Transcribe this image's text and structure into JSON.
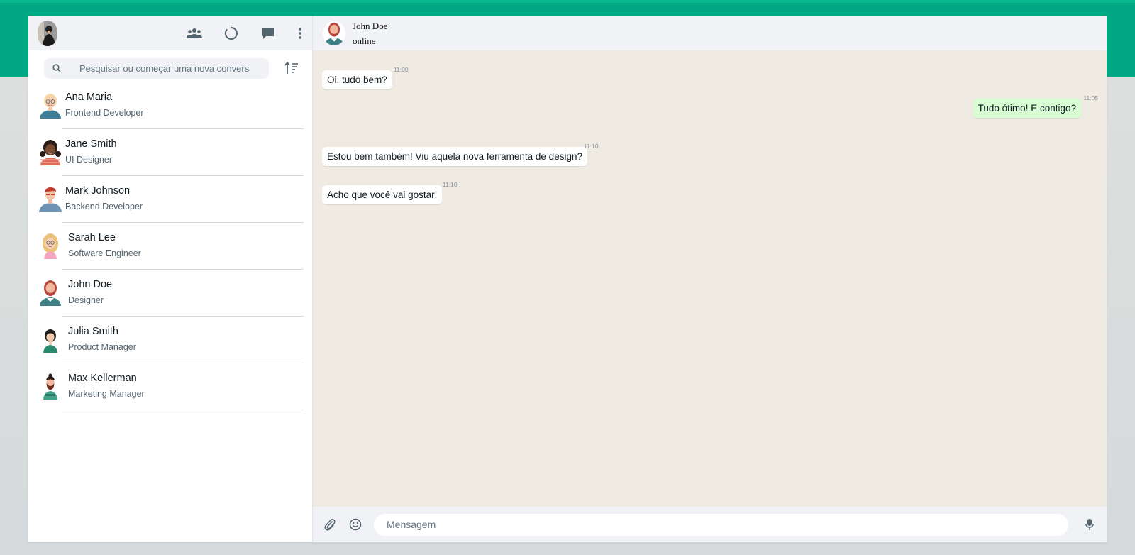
{
  "colors": {
    "accent": "#00a884",
    "panel": "#f0f2f5",
    "chat_bg": "#efeae2",
    "bubble_out": "#d9fdd3",
    "icon": "#54656f"
  },
  "sidebar": {
    "header_icons": [
      "community-icon",
      "status-icon",
      "new-chat-icon",
      "menu-icon"
    ],
    "search": {
      "placeholder": "Pesquisar ou começar uma nova conversa"
    },
    "contacts": [
      {
        "name": "Ana Maria",
        "role": "Frontend Developer",
        "avatar": "woman-glasses-avatar"
      },
      {
        "name": "Jane Smith",
        "role": "UI Designer",
        "avatar": "woman-dark-hair-avatar"
      },
      {
        "name": "Mark Johnson",
        "role": "Backend Developer",
        "avatar": "man-red-hair-avatar"
      },
      {
        "name": "Sarah Lee",
        "role": "Software Engineer",
        "avatar": "woman-blonde-avatar"
      },
      {
        "name": "John Doe",
        "role": "Designer",
        "avatar": "man-beard-avatar"
      },
      {
        "name": "Julia Smith",
        "role": "Product Manager",
        "avatar": "woman-green-top-avatar"
      },
      {
        "name": "Max Kellerman",
        "role": "Marketing Manager",
        "avatar": "man-beard-green-avatar"
      }
    ]
  },
  "chat": {
    "contact_name": "John Doe",
    "status": "online",
    "messages": [
      {
        "text": "Oi, tudo bem?",
        "time": "11:00",
        "direction": "in"
      },
      {
        "text": "Tudo ótimo! E contigo?",
        "time": "11:05",
        "direction": "out"
      },
      {
        "text": "Estou bem também! Viu aquela nova ferramenta de design?",
        "time": "11:10",
        "direction": "in"
      },
      {
        "text": "Acho que você vai gostar!",
        "time": "11:10",
        "direction": "in"
      }
    ],
    "composer": {
      "placeholder": "Mensagem"
    }
  }
}
